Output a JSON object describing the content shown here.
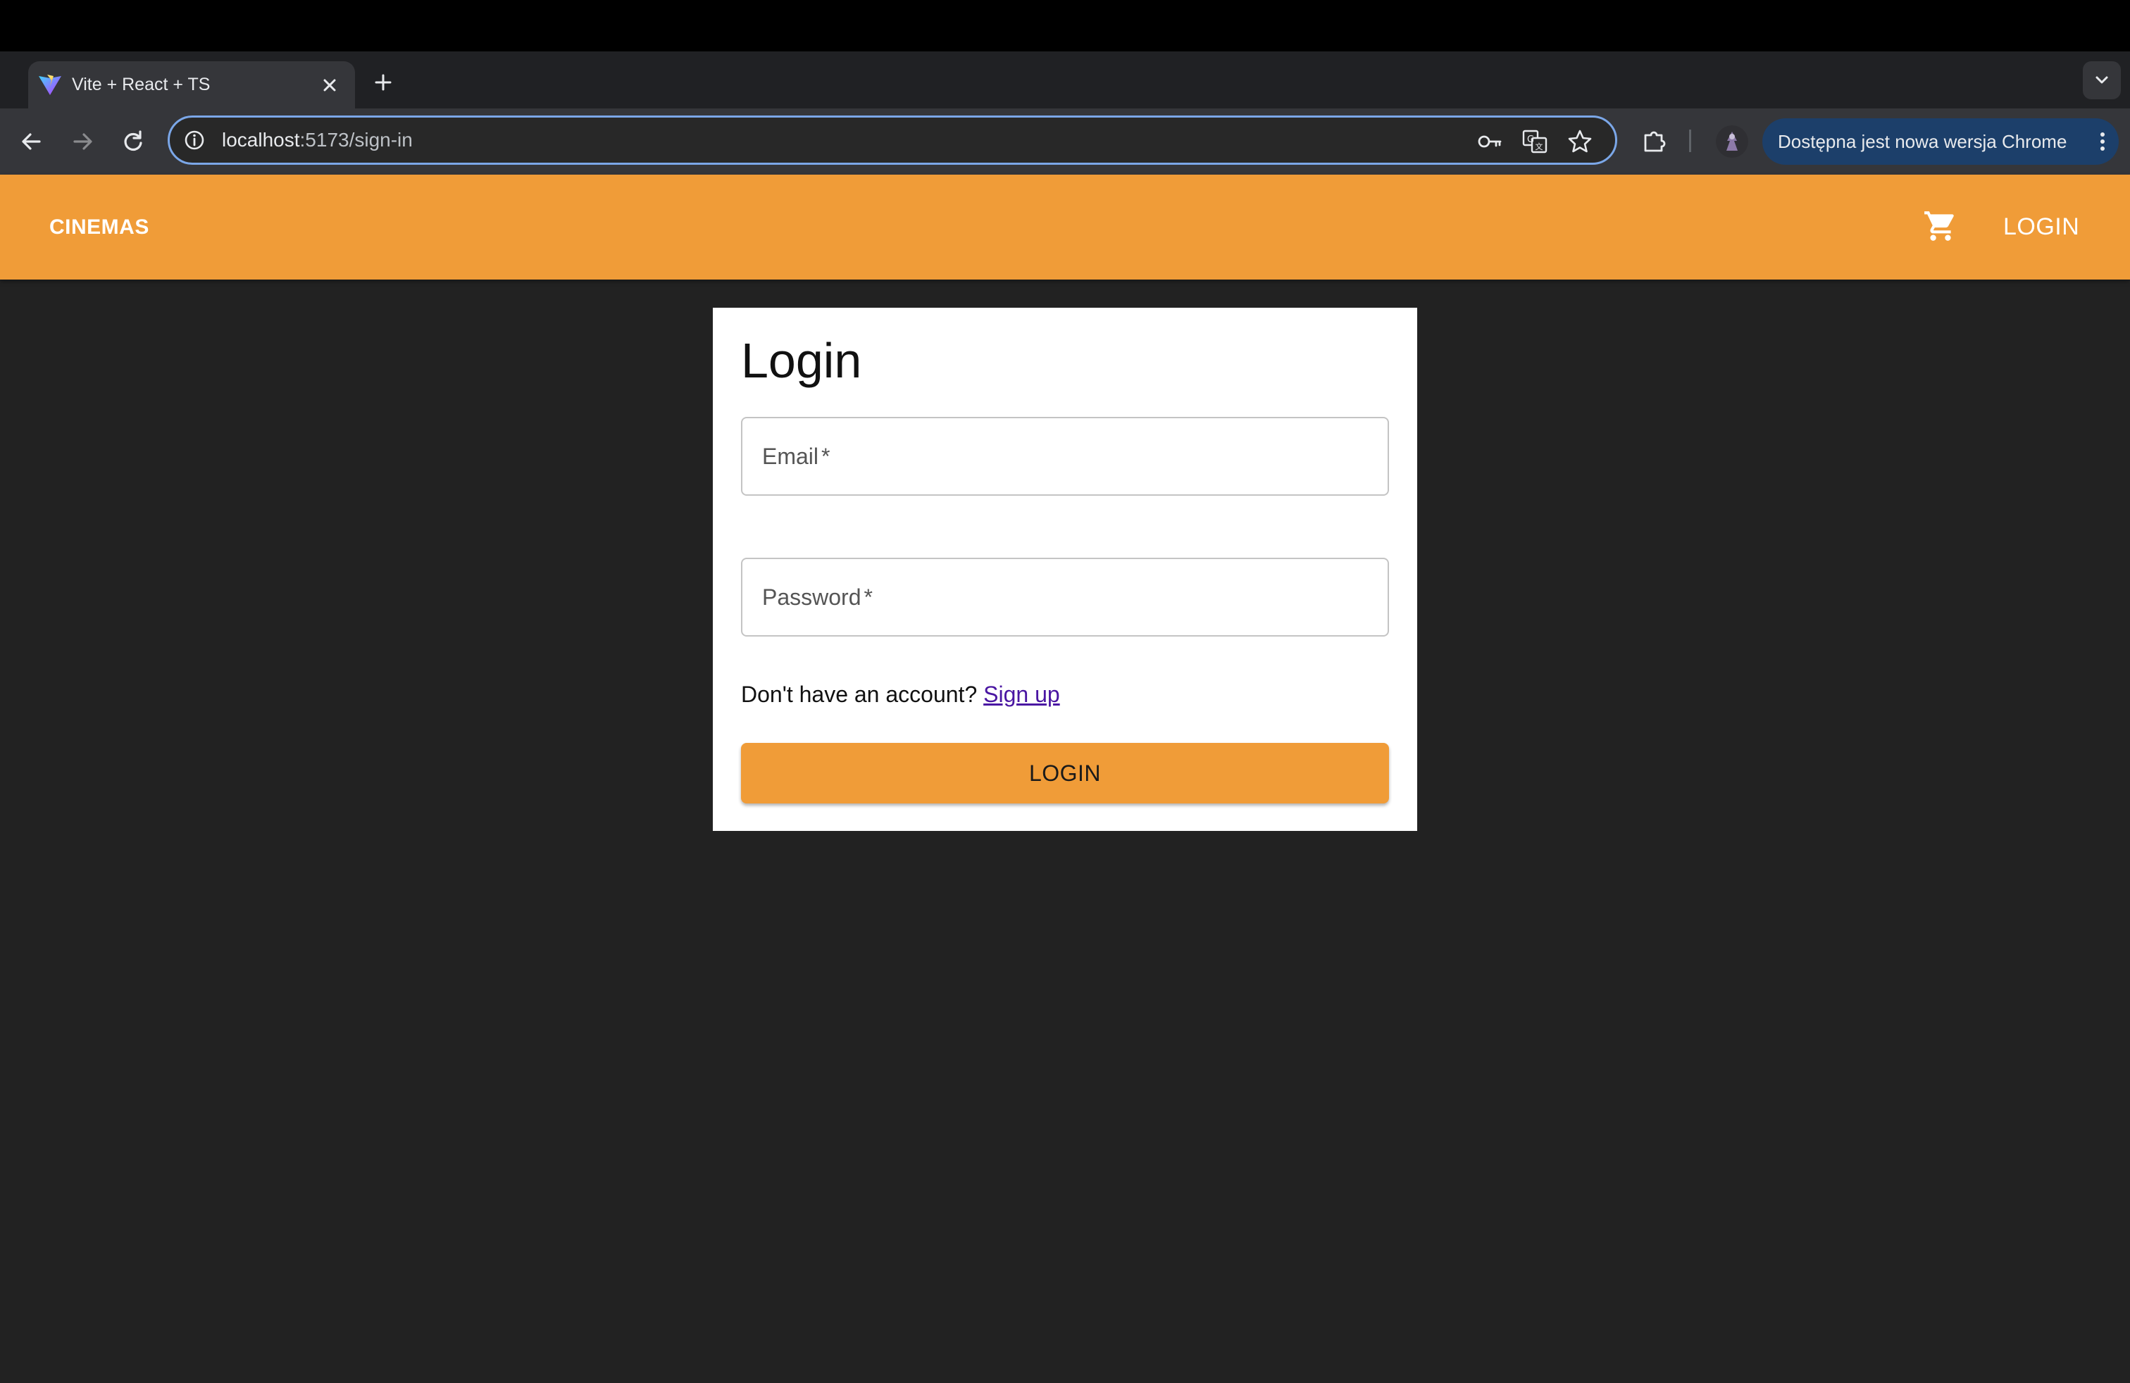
{
  "browser": {
    "tab": {
      "title": "Vite + React + TS",
      "favicon": "vite-logo-icon"
    },
    "url": {
      "host": "localhost",
      "path": ":5173/sign-in"
    },
    "update_banner": "Dostępna jest nowa wersja Chrome",
    "icons": [
      "back-icon",
      "forward-icon",
      "reload-icon",
      "site-info-icon",
      "password-key-icon",
      "translate-icon",
      "bookmark-star-icon",
      "extensions-icon",
      "profile-avatar",
      "more-vert-icon",
      "tab-search-icon"
    ]
  },
  "app": {
    "brand": "CINEMAS",
    "nav": {
      "cart_icon": "shopping-cart-icon",
      "login_label": "LOGIN"
    },
    "colors": {
      "accent": "#f09c38",
      "background": "#222222",
      "card": "#ffffff",
      "link": "#4a16a2"
    }
  },
  "login_form": {
    "title": "Login",
    "email": {
      "label": "Email",
      "required_mark": "*",
      "value": ""
    },
    "password": {
      "label": "Password",
      "required_mark": "*",
      "value": ""
    },
    "account_prompt": "Don't have an account?",
    "signup_link": "Sign up",
    "submit_label": "LOGIN"
  }
}
